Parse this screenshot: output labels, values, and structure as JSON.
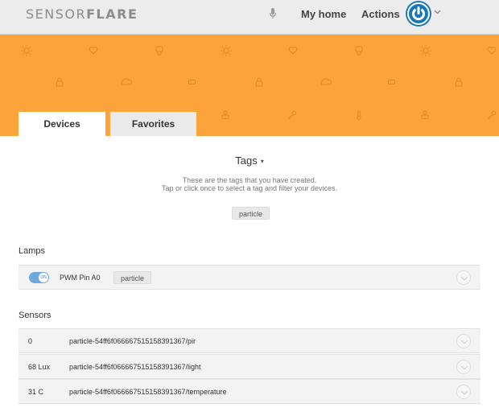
{
  "header": {
    "logo_part1": "SENSOR",
    "logo_part2": "FLARE",
    "mic_icon": "microphone-icon",
    "nav": {
      "home": "My home",
      "actions": "Actions"
    },
    "avatar_icon": "power-icon",
    "menu_icon": "chevron-down-icon"
  },
  "colors": {
    "banner": "#fca33b",
    "header": "#ececec",
    "avatar": "#1878b5",
    "toggle_on": "#6fa8de"
  },
  "banner": {
    "pattern_icons": [
      "sun-icon",
      "heart-icon",
      "bulb-icon",
      "lock-icon",
      "cloud-icon",
      "battery-icon",
      "person-icon",
      "key-icon",
      "thermometer-icon"
    ]
  },
  "tabs": [
    {
      "label": "Devices",
      "active": true
    },
    {
      "label": "Favorites",
      "active": false
    }
  ],
  "tags": {
    "title": "Tags",
    "caret": "▾",
    "desc_line1": "These are the tags that you have created.",
    "desc_line2": "Tap or click once to select a tag and filter your devices.",
    "items": [
      "particle"
    ]
  },
  "lamps": {
    "title": "Lamps",
    "rows": [
      {
        "toggle_label": "ON",
        "name": "PWM Pin A0",
        "tag": "particle"
      }
    ]
  },
  "sensors": {
    "title": "Sensors",
    "rows": [
      {
        "value": "0",
        "name": "particle-54ff6f066667515158391367/pir"
      },
      {
        "value": "68 Lux",
        "name": "particle-54ff6f066667515158391367/light"
      },
      {
        "value": "31 C",
        "name": "particle-54ff6f066667515158391367/temperature"
      }
    ]
  }
}
